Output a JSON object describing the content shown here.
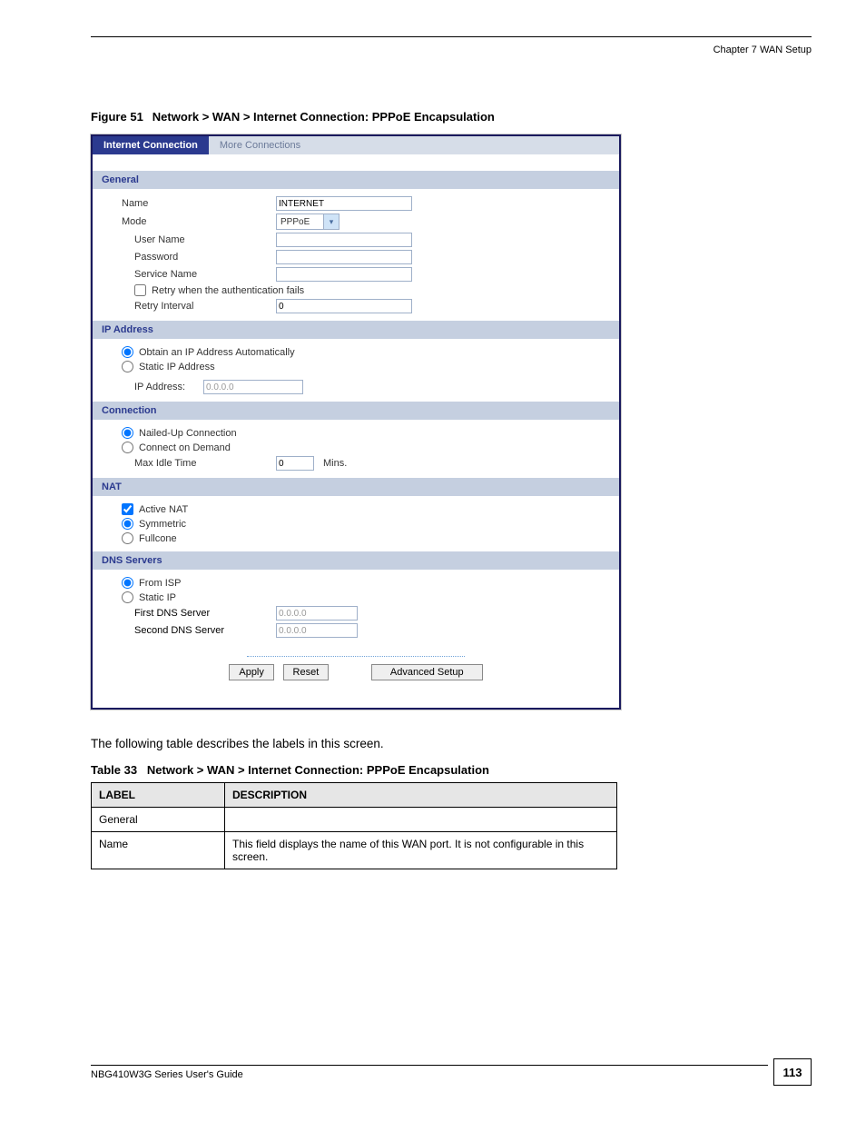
{
  "chapter_header": "Chapter 7 WAN Setup",
  "figure_caption_no": "Figure 51",
  "figure_caption_text": "Network > WAN > Internet Connection: PPPoE Encapsulation",
  "tabs": {
    "active": "Internet Connection",
    "inactive": "More Connections"
  },
  "sections": {
    "general": {
      "title": "General",
      "name_label": "Name",
      "name_value": "INTERNET",
      "mode_label": "Mode",
      "mode_value": "PPPoE",
      "user_name_label": "User Name",
      "password_label": "Password",
      "service_name_label": "Service Name",
      "retry_checkbox": "Retry when the authentication fails",
      "retry_interval_label": "Retry Interval",
      "retry_interval_value": "0"
    },
    "ip": {
      "title": "IP Address",
      "auto_label": "Obtain an IP Address Automatically",
      "static_label": "Static IP Address",
      "ip_label": "IP Address:",
      "ip_value": "0.0.0.0"
    },
    "connection": {
      "title": "Connection",
      "nailed_label": "Nailed-Up Connection",
      "demand_label": "Connect on Demand",
      "max_idle_label": "Max Idle Time",
      "max_idle_value": "0",
      "mins": "Mins."
    },
    "nat": {
      "title": "NAT",
      "active_label": "Active NAT",
      "symmetric_label": "Symmetric",
      "fullcone_label": "Fullcone"
    },
    "dns": {
      "title": "DNS Servers",
      "from_isp_label": "From ISP",
      "static_label": "Static IP",
      "first_label": "First DNS Server",
      "first_value": "0.0.0.0",
      "second_label": "Second DNS Server",
      "second_value": "0.0.0.0"
    },
    "buttons": {
      "apply": "Apply",
      "reset": "Reset",
      "advanced": "Advanced Setup"
    }
  },
  "body_text": "The following table describes the labels in this screen.",
  "table_caption_no": "Table 33",
  "table_caption_text": "Network > WAN > Internet Connection: PPPoE Encapsulation",
  "table": {
    "head_label": "LABEL",
    "head_desc": "DESCRIPTION",
    "rows": [
      {
        "label": "General",
        "desc": ""
      },
      {
        "label": "Name",
        "desc": "This field displays the name of this WAN port. It is not configurable in this screen."
      }
    ]
  },
  "footer_text": "NBG410W3G Series User's Guide",
  "page_number": "113"
}
